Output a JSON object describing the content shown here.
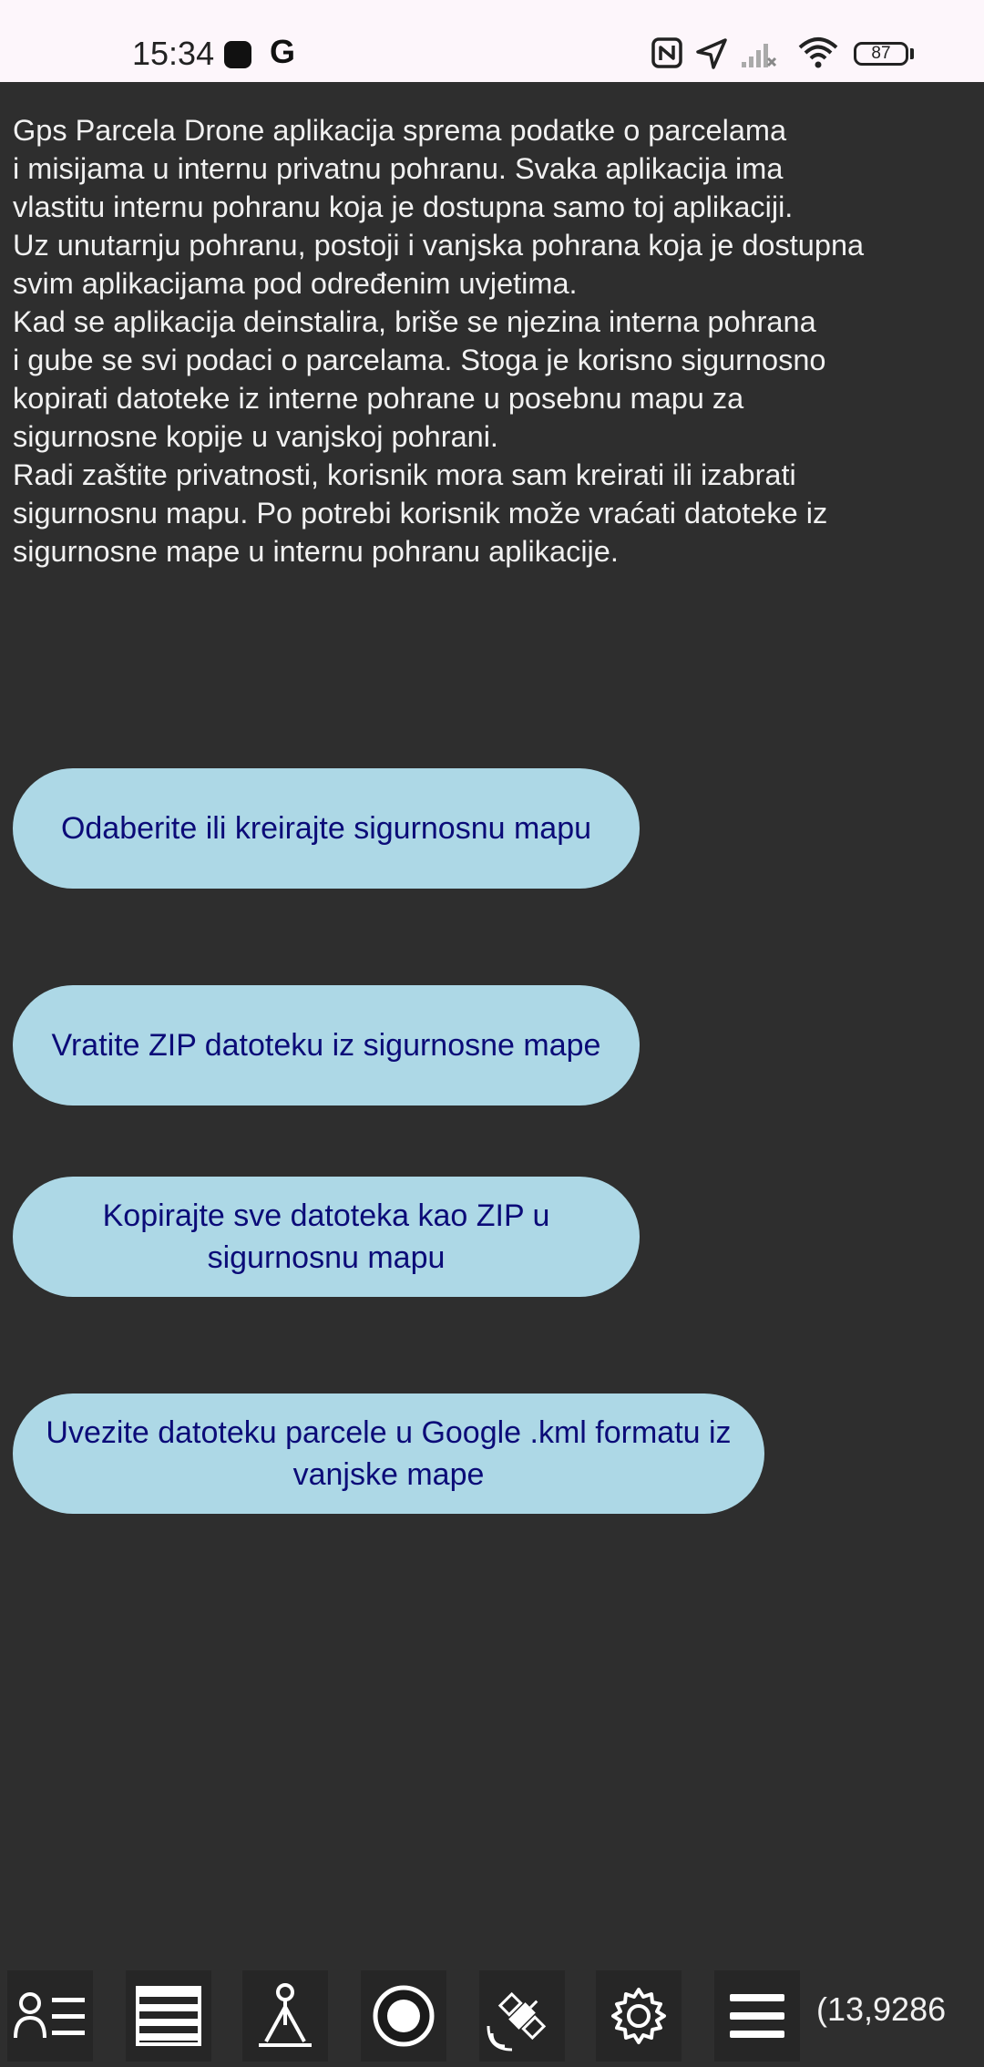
{
  "status_bar": {
    "time": "15:34",
    "google_letter": "G",
    "battery_level": "87",
    "icons": [
      "app-notification-icon",
      "google-icon",
      "nfc-icon",
      "location-arrow-icon",
      "signal-off-icon",
      "wifi-icon",
      "battery-icon"
    ]
  },
  "info_text": "Gps Parcela Drone aplikacija sprema podatke o parcelama\ni misijama u internu privatnu pohranu. Svaka aplikacija ima\nvlastitu internu pohranu koja je dostupna samo toj aplikaciji.\nUz unutarnju pohranu, postoji i vanjska pohrana koja je dostupna\nsvim aplikacijama pod određenim uvjetima.\nKad se aplikacija deinstalira, briše se njezina interna pohrana\ni gube se svi podaci o parcelama. Stoga je korisno sigurnosno\nkopirati datoteke iz interne pohrane u posebnu mapu za\nsigurnosne kopije u vanjskoj pohrani.\nRadi zaštite privatnosti, korisnik mora sam kreirati ili izabrati\nsigurnosnu mapu. Po potrebi korisnik može vraćati datoteke iz\nsigurnosne mape u internu pohranu aplikacije.",
  "buttons": {
    "select_folder": "Odaberite ili kreirajte sigurnosnu mapu",
    "restore_zip": "Vratite ZIP datoteku iz sigurnosne mape",
    "copy_zip": "Kopirajte sve datoteka kao ZIP u sigurnosnu mapu",
    "import_kml": "Uvezite datoteku parcele u Google .kml formatu iz vanjske mape"
  },
  "toolbar": {
    "icons": [
      "person-list-icon",
      "stack-icon",
      "survey-tripod-icon",
      "record-icon",
      "satellite-icon",
      "gear-icon",
      "menu-icon"
    ],
    "coordinates": "(13,9286"
  },
  "colors": {
    "background": "#2e2e2e",
    "button_fill": "#add8e6",
    "button_text": "#0b0b78",
    "status_bar": "#fdf6fb"
  }
}
